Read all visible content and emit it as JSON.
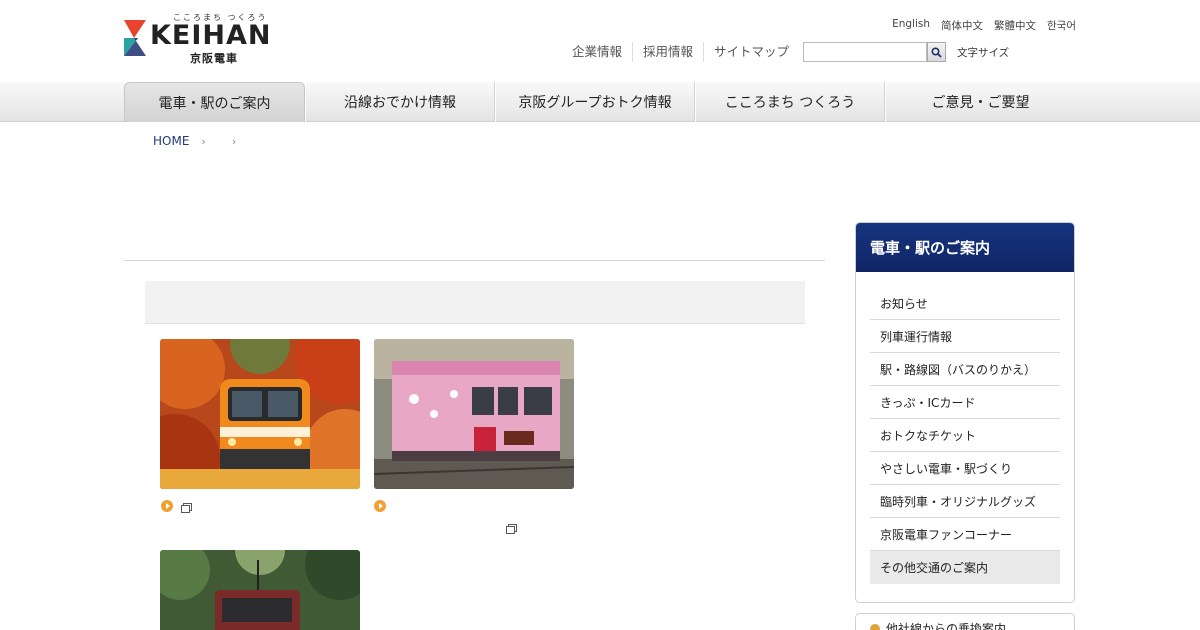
{
  "logo": {
    "tagline": "こころまち つくろう",
    "wordmark": "KEIHAN",
    "subtitle": "京阪電車",
    "colors": {
      "red": "#e8432d",
      "teal": "#2ba3a1",
      "navy": "#1d2f6f"
    }
  },
  "languages": [
    "English",
    "简体中文",
    "繁體中文",
    "한국어"
  ],
  "utility_links": [
    "企業情報",
    "採用情報",
    "サイトマップ"
  ],
  "search": {
    "value": "",
    "placeholder": "",
    "button_icon": "search-icon"
  },
  "font_size_label": "文字サイズ",
  "global_nav": [
    {
      "label": "電車・駅のご案内",
      "active": true
    },
    {
      "label": "沿線おでかけ情報",
      "active": false
    },
    {
      "label": "京阪グループおトク情報",
      "active": false
    },
    {
      "label": "こころまち つくろう",
      "active": false
    },
    {
      "label": "ご意見・ご要望",
      "active": false
    }
  ],
  "breadcrumb": {
    "home": "HOME"
  },
  "sidebar": {
    "heading": "電車・駅のご案内",
    "heading_color": "#14307a",
    "items": [
      "お知らせ",
      "列車運行情報",
      "駅・路線図（バスのりかえ）",
      "きっぷ・ICカード",
      "おトクなチケット",
      "やさしい電車・駅づくり",
      "臨時列車・オリジナルグッズ",
      "京阪電車ファンコーナー",
      "その他交通のご案内"
    ],
    "current_item_index": 8,
    "second_box_label": "他社線からの乗換案内"
  },
  "accent_color": "#f0a033"
}
